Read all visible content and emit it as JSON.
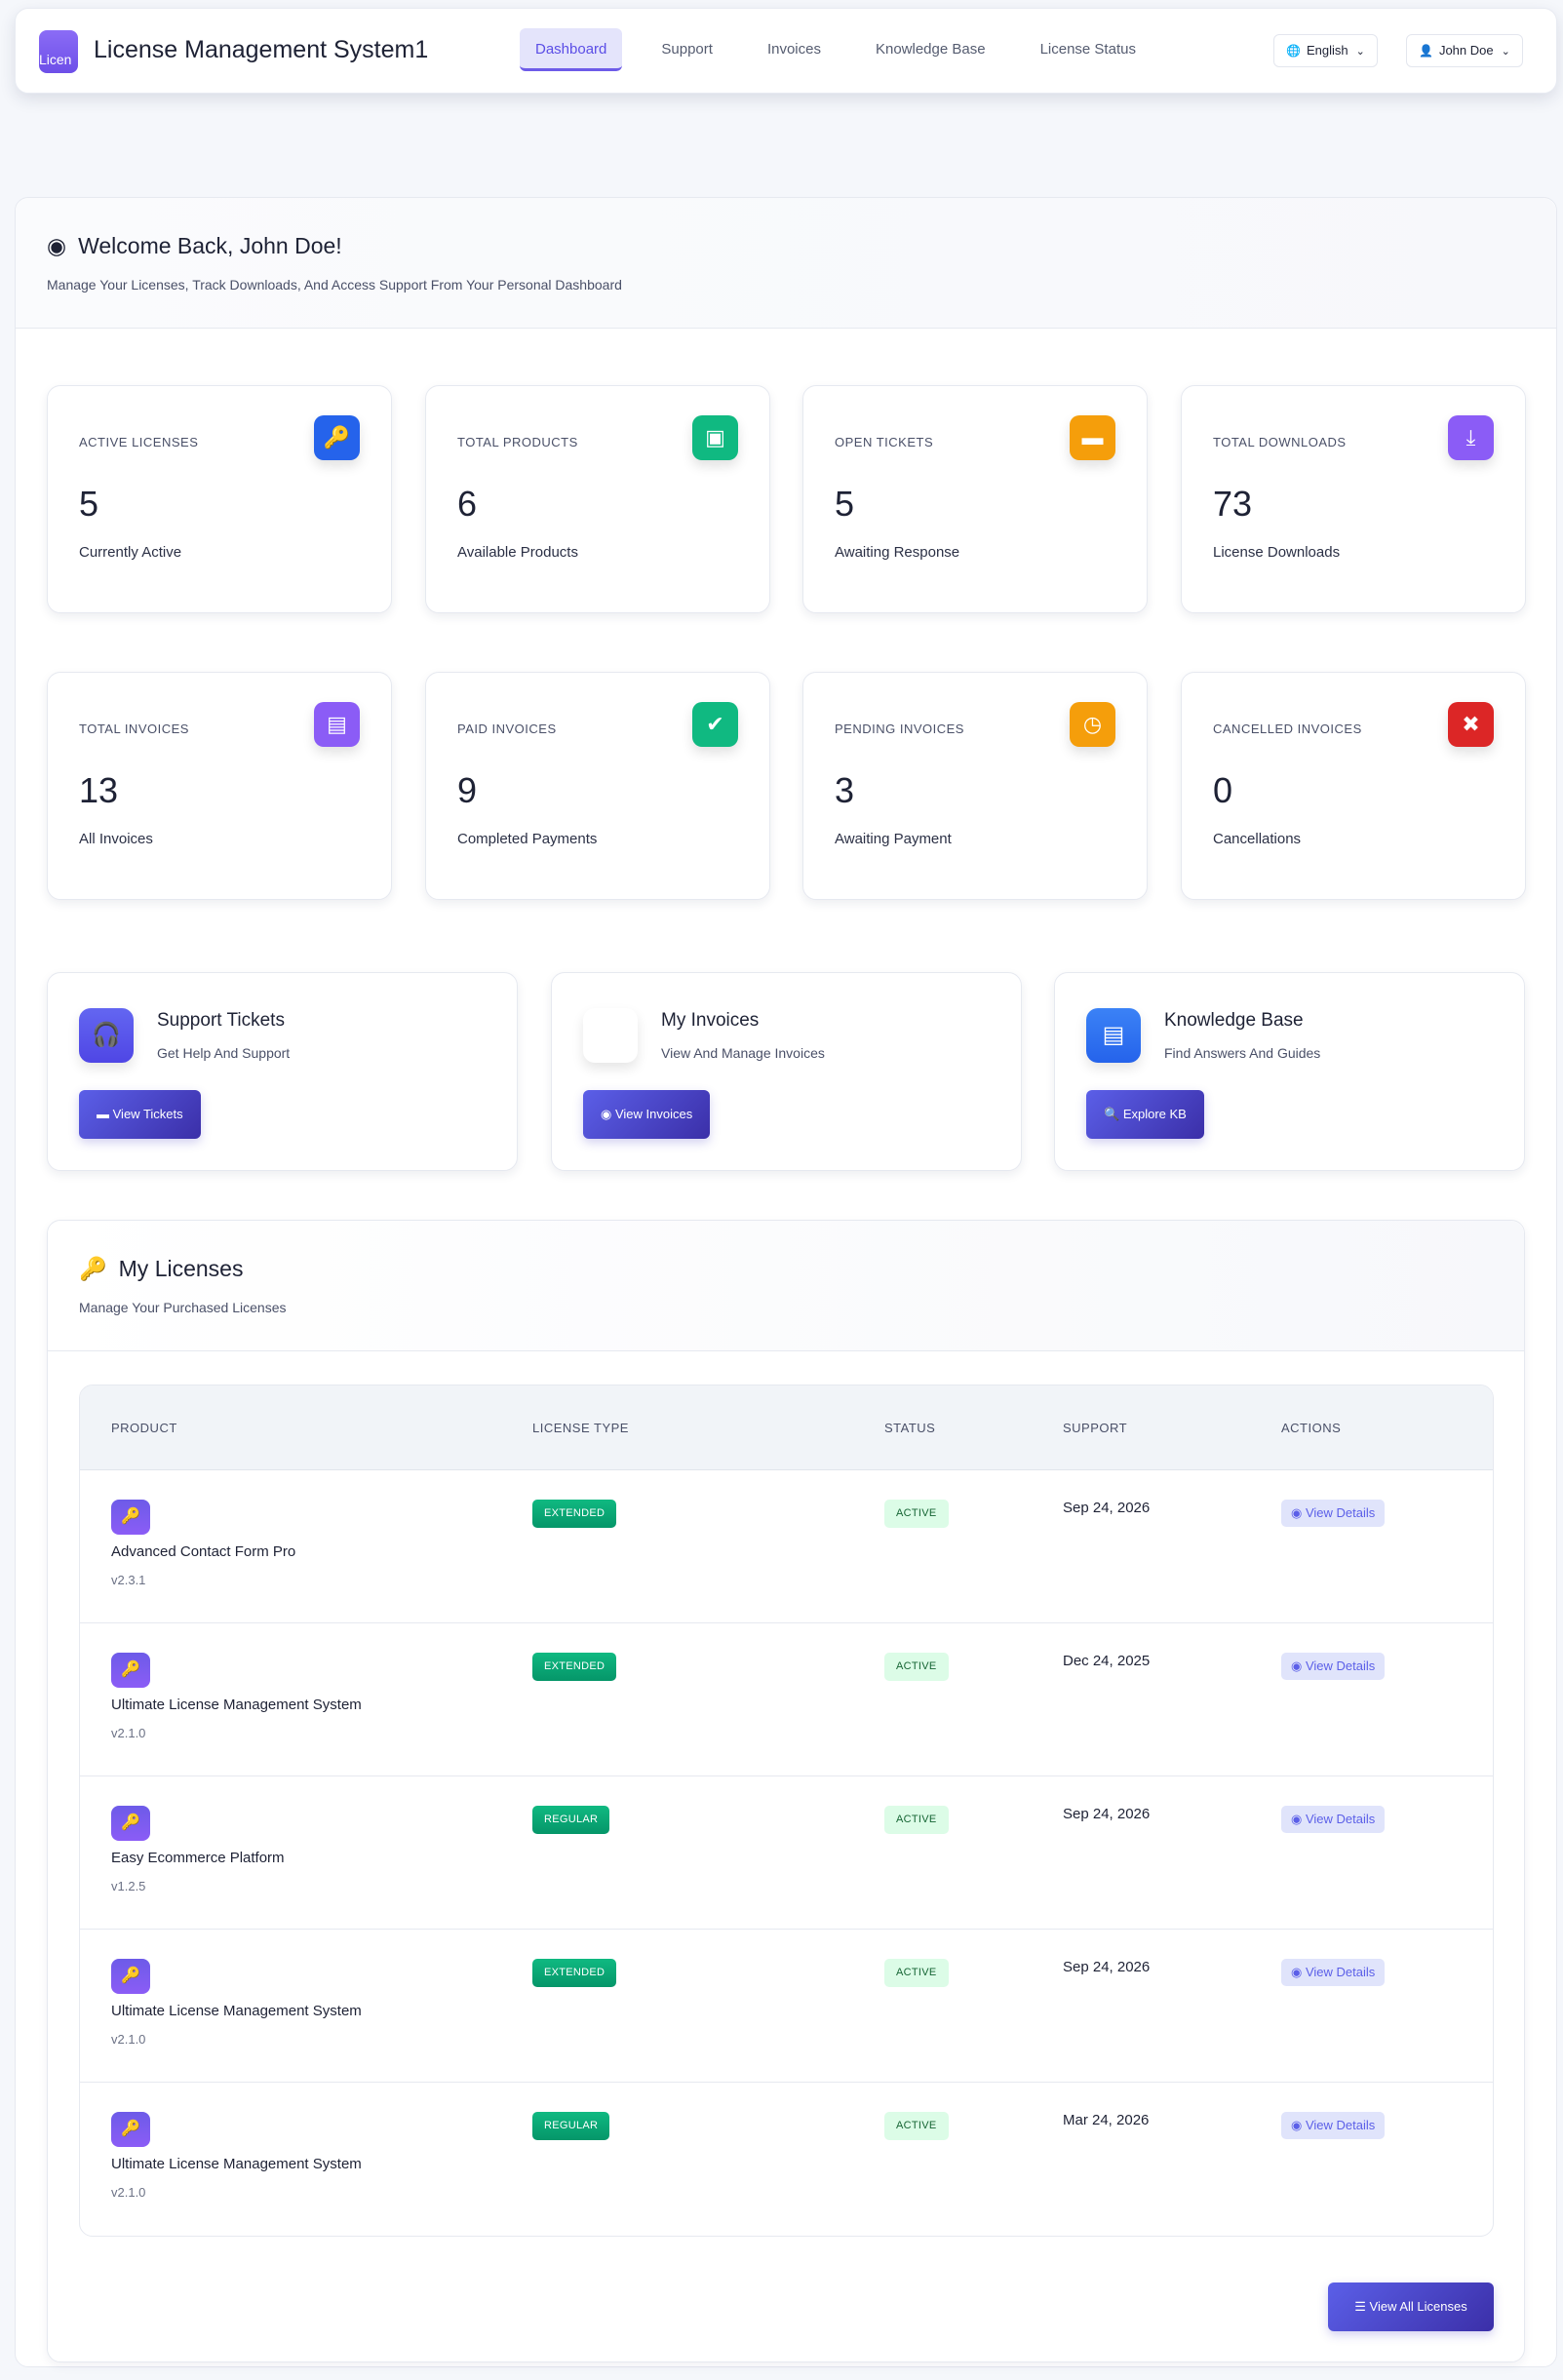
{
  "header": {
    "title": "License Management System1",
    "logo_text": "Licen",
    "nav": [
      "Dashboard",
      "Support",
      "Invoices",
      "Knowledge Base",
      "License Status"
    ],
    "active_nav": "Dashboard",
    "language": "English",
    "user": "John Doe"
  },
  "welcome": {
    "title": "Welcome Back, John Doe!",
    "subtitle": "Manage Your Licenses, Track Downloads, And Access Support From Your Personal Dashboard"
  },
  "stats": [
    {
      "label": "ACTIVE LICENSES",
      "value": "5",
      "sub": "Currently Active",
      "icon": "key-icon",
      "color": "#2563eb"
    },
    {
      "label": "TOTAL PRODUCTS",
      "value": "6",
      "sub": "Available Products",
      "icon": "box-icon",
      "color": "#10b981"
    },
    {
      "label": "OPEN TICKETS",
      "value": "5",
      "sub": "Awaiting Response",
      "icon": "ticket-icon",
      "color": "#f59e0b"
    },
    {
      "label": "TOTAL DOWNLOADS",
      "value": "73",
      "sub": "License Downloads",
      "icon": "download-icon",
      "color": "#8b5cf6"
    },
    {
      "label": "TOTAL INVOICES",
      "value": "13",
      "sub": "All Invoices",
      "icon": "invoice-icon",
      "color": "#8b5cf6"
    },
    {
      "label": "PAID INVOICES",
      "value": "9",
      "sub": "Completed Payments",
      "icon": "check-circle-icon",
      "color": "#10b981"
    },
    {
      "label": "PENDING INVOICES",
      "value": "3",
      "sub": "Awaiting Payment",
      "icon": "clock-icon",
      "color": "#f59e0b"
    },
    {
      "label": "CANCELLED INVOICES",
      "value": "0",
      "sub": "Cancellations",
      "icon": "x-circle-icon",
      "color": "#dc2626"
    }
  ],
  "actions": [
    {
      "title": "Support Tickets",
      "subtitle": "Get Help And Support",
      "button": "View Tickets"
    },
    {
      "title": "My Invoices",
      "subtitle": "View And Manage Invoices",
      "button": "View Invoices"
    },
    {
      "title": "Knowledge Base",
      "subtitle": "Find Answers And Guides",
      "button": "Explore KB"
    }
  ],
  "licenses": {
    "title": "My Licenses",
    "subtitle": "Manage Your Purchased Licenses",
    "columns": [
      "PRODUCT",
      "LICENSE TYPE",
      "STATUS",
      "SUPPORT",
      "ACTIONS"
    ],
    "rows": [
      {
        "product": "Advanced Contact Form Pro",
        "version": "v2.3.1",
        "type": "EXTENDED",
        "status": "ACTIVE",
        "support": "Sep 24, 2026",
        "action": "View Details"
      },
      {
        "product": "Ultimate License Management System",
        "version": "v2.1.0",
        "type": "EXTENDED",
        "status": "ACTIVE",
        "support": "Dec 24, 2025",
        "action": "View Details"
      },
      {
        "product": "Easy Ecommerce Platform",
        "version": "v1.2.5",
        "type": "REGULAR",
        "status": "ACTIVE",
        "support": "Sep 24, 2026",
        "action": "View Details"
      },
      {
        "product": "Ultimate License Management System",
        "version": "v2.1.0",
        "type": "EXTENDED",
        "status": "ACTIVE",
        "support": "Sep 24, 2026",
        "action": "View Details"
      },
      {
        "product": "Ultimate License Management System",
        "version": "v2.1.0",
        "type": "REGULAR",
        "status": "ACTIVE",
        "support": "Mar 24, 2026",
        "action": "View Details"
      }
    ],
    "view_all": "View All Licenses"
  }
}
